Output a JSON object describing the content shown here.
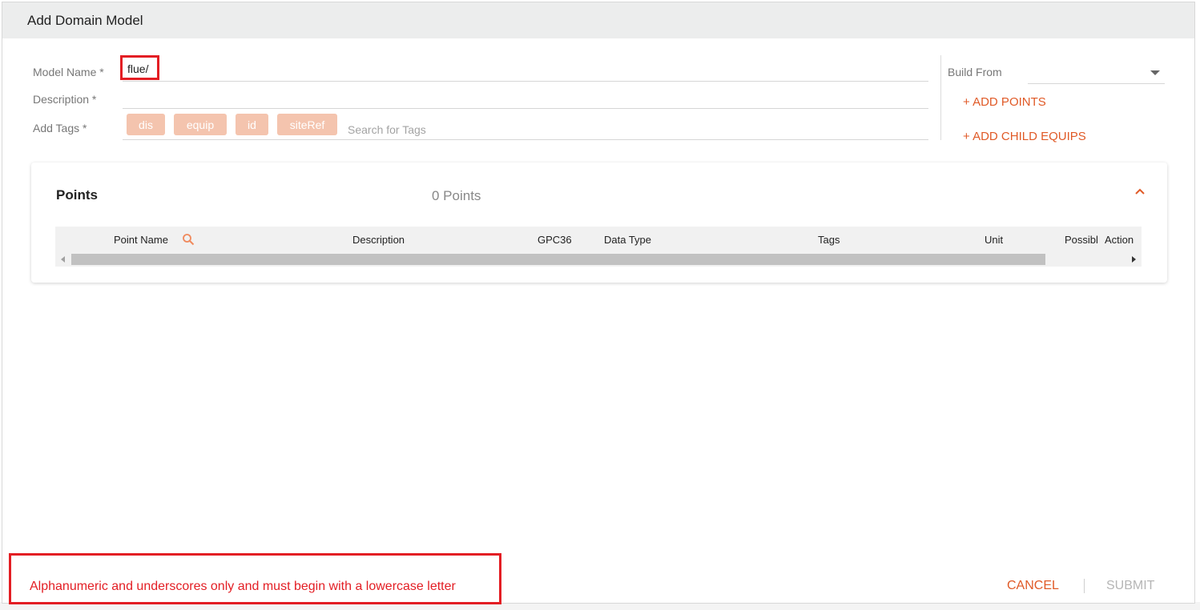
{
  "dialog": {
    "title": "Add Domain Model"
  },
  "form": {
    "model_name_label": "Model Name *",
    "model_name_value": "flue/",
    "description_label": "Description *",
    "description_value": "",
    "tags_label": "Add Tags *",
    "tags": [
      "dis",
      "equip",
      "id",
      "siteRef"
    ],
    "tag_search_placeholder": "Search for Tags"
  },
  "side": {
    "build_from_label": "Build From",
    "build_from_value": "",
    "add_points": "+ ADD POINTS",
    "add_child_equips": "+ ADD CHILD EQUIPS"
  },
  "points": {
    "title": "Points",
    "count_text": "0 Points",
    "columns": [
      "Point Name",
      "Description",
      "GPC36",
      "Data Type",
      "Tags",
      "Unit",
      "Possibl",
      "Action"
    ]
  },
  "validation": {
    "error": "Alphanumeric and underscores only and must begin with a lowercase letter"
  },
  "footer": {
    "cancel": "CANCEL",
    "submit": "SUBMIT"
  },
  "colors": {
    "accent": "#e05a27",
    "tag_chip": "#f4c4ae",
    "error": "#e31e24",
    "disabled": "#b5b5b5"
  },
  "icons": {
    "search": "magnifier-icon",
    "collapse": "chevron-up-icon",
    "caret": "caret-down-icon"
  }
}
